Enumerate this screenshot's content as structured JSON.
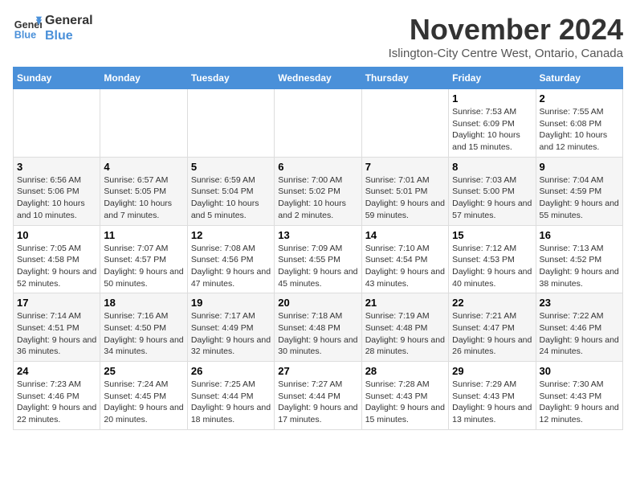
{
  "logo": {
    "line1": "General",
    "line2": "Blue"
  },
  "title": "November 2024",
  "subtitle": "Islington-City Centre West, Ontario, Canada",
  "weekdays": [
    "Sunday",
    "Monday",
    "Tuesday",
    "Wednesday",
    "Thursday",
    "Friday",
    "Saturday"
  ],
  "weeks": [
    [
      {
        "day": "",
        "info": ""
      },
      {
        "day": "",
        "info": ""
      },
      {
        "day": "",
        "info": ""
      },
      {
        "day": "",
        "info": ""
      },
      {
        "day": "",
        "info": ""
      },
      {
        "day": "1",
        "info": "Sunrise: 7:53 AM\nSunset: 6:09 PM\nDaylight: 10 hours and 15 minutes."
      },
      {
        "day": "2",
        "info": "Sunrise: 7:55 AM\nSunset: 6:08 PM\nDaylight: 10 hours and 12 minutes."
      }
    ],
    [
      {
        "day": "3",
        "info": "Sunrise: 6:56 AM\nSunset: 5:06 PM\nDaylight: 10 hours and 10 minutes."
      },
      {
        "day": "4",
        "info": "Sunrise: 6:57 AM\nSunset: 5:05 PM\nDaylight: 10 hours and 7 minutes."
      },
      {
        "day": "5",
        "info": "Sunrise: 6:59 AM\nSunset: 5:04 PM\nDaylight: 10 hours and 5 minutes."
      },
      {
        "day": "6",
        "info": "Sunrise: 7:00 AM\nSunset: 5:02 PM\nDaylight: 10 hours and 2 minutes."
      },
      {
        "day": "7",
        "info": "Sunrise: 7:01 AM\nSunset: 5:01 PM\nDaylight: 9 hours and 59 minutes."
      },
      {
        "day": "8",
        "info": "Sunrise: 7:03 AM\nSunset: 5:00 PM\nDaylight: 9 hours and 57 minutes."
      },
      {
        "day": "9",
        "info": "Sunrise: 7:04 AM\nSunset: 4:59 PM\nDaylight: 9 hours and 55 minutes."
      }
    ],
    [
      {
        "day": "10",
        "info": "Sunrise: 7:05 AM\nSunset: 4:58 PM\nDaylight: 9 hours and 52 minutes."
      },
      {
        "day": "11",
        "info": "Sunrise: 7:07 AM\nSunset: 4:57 PM\nDaylight: 9 hours and 50 minutes."
      },
      {
        "day": "12",
        "info": "Sunrise: 7:08 AM\nSunset: 4:56 PM\nDaylight: 9 hours and 47 minutes."
      },
      {
        "day": "13",
        "info": "Sunrise: 7:09 AM\nSunset: 4:55 PM\nDaylight: 9 hours and 45 minutes."
      },
      {
        "day": "14",
        "info": "Sunrise: 7:10 AM\nSunset: 4:54 PM\nDaylight: 9 hours and 43 minutes."
      },
      {
        "day": "15",
        "info": "Sunrise: 7:12 AM\nSunset: 4:53 PM\nDaylight: 9 hours and 40 minutes."
      },
      {
        "day": "16",
        "info": "Sunrise: 7:13 AM\nSunset: 4:52 PM\nDaylight: 9 hours and 38 minutes."
      }
    ],
    [
      {
        "day": "17",
        "info": "Sunrise: 7:14 AM\nSunset: 4:51 PM\nDaylight: 9 hours and 36 minutes."
      },
      {
        "day": "18",
        "info": "Sunrise: 7:16 AM\nSunset: 4:50 PM\nDaylight: 9 hours and 34 minutes."
      },
      {
        "day": "19",
        "info": "Sunrise: 7:17 AM\nSunset: 4:49 PM\nDaylight: 9 hours and 32 minutes."
      },
      {
        "day": "20",
        "info": "Sunrise: 7:18 AM\nSunset: 4:48 PM\nDaylight: 9 hours and 30 minutes."
      },
      {
        "day": "21",
        "info": "Sunrise: 7:19 AM\nSunset: 4:48 PM\nDaylight: 9 hours and 28 minutes."
      },
      {
        "day": "22",
        "info": "Sunrise: 7:21 AM\nSunset: 4:47 PM\nDaylight: 9 hours and 26 minutes."
      },
      {
        "day": "23",
        "info": "Sunrise: 7:22 AM\nSunset: 4:46 PM\nDaylight: 9 hours and 24 minutes."
      }
    ],
    [
      {
        "day": "24",
        "info": "Sunrise: 7:23 AM\nSunset: 4:46 PM\nDaylight: 9 hours and 22 minutes."
      },
      {
        "day": "25",
        "info": "Sunrise: 7:24 AM\nSunset: 4:45 PM\nDaylight: 9 hours and 20 minutes."
      },
      {
        "day": "26",
        "info": "Sunrise: 7:25 AM\nSunset: 4:44 PM\nDaylight: 9 hours and 18 minutes."
      },
      {
        "day": "27",
        "info": "Sunrise: 7:27 AM\nSunset: 4:44 PM\nDaylight: 9 hours and 17 minutes."
      },
      {
        "day": "28",
        "info": "Sunrise: 7:28 AM\nSunset: 4:43 PM\nDaylight: 9 hours and 15 minutes."
      },
      {
        "day": "29",
        "info": "Sunrise: 7:29 AM\nSunset: 4:43 PM\nDaylight: 9 hours and 13 minutes."
      },
      {
        "day": "30",
        "info": "Sunrise: 7:30 AM\nSunset: 4:43 PM\nDaylight: 9 hours and 12 minutes."
      }
    ]
  ]
}
